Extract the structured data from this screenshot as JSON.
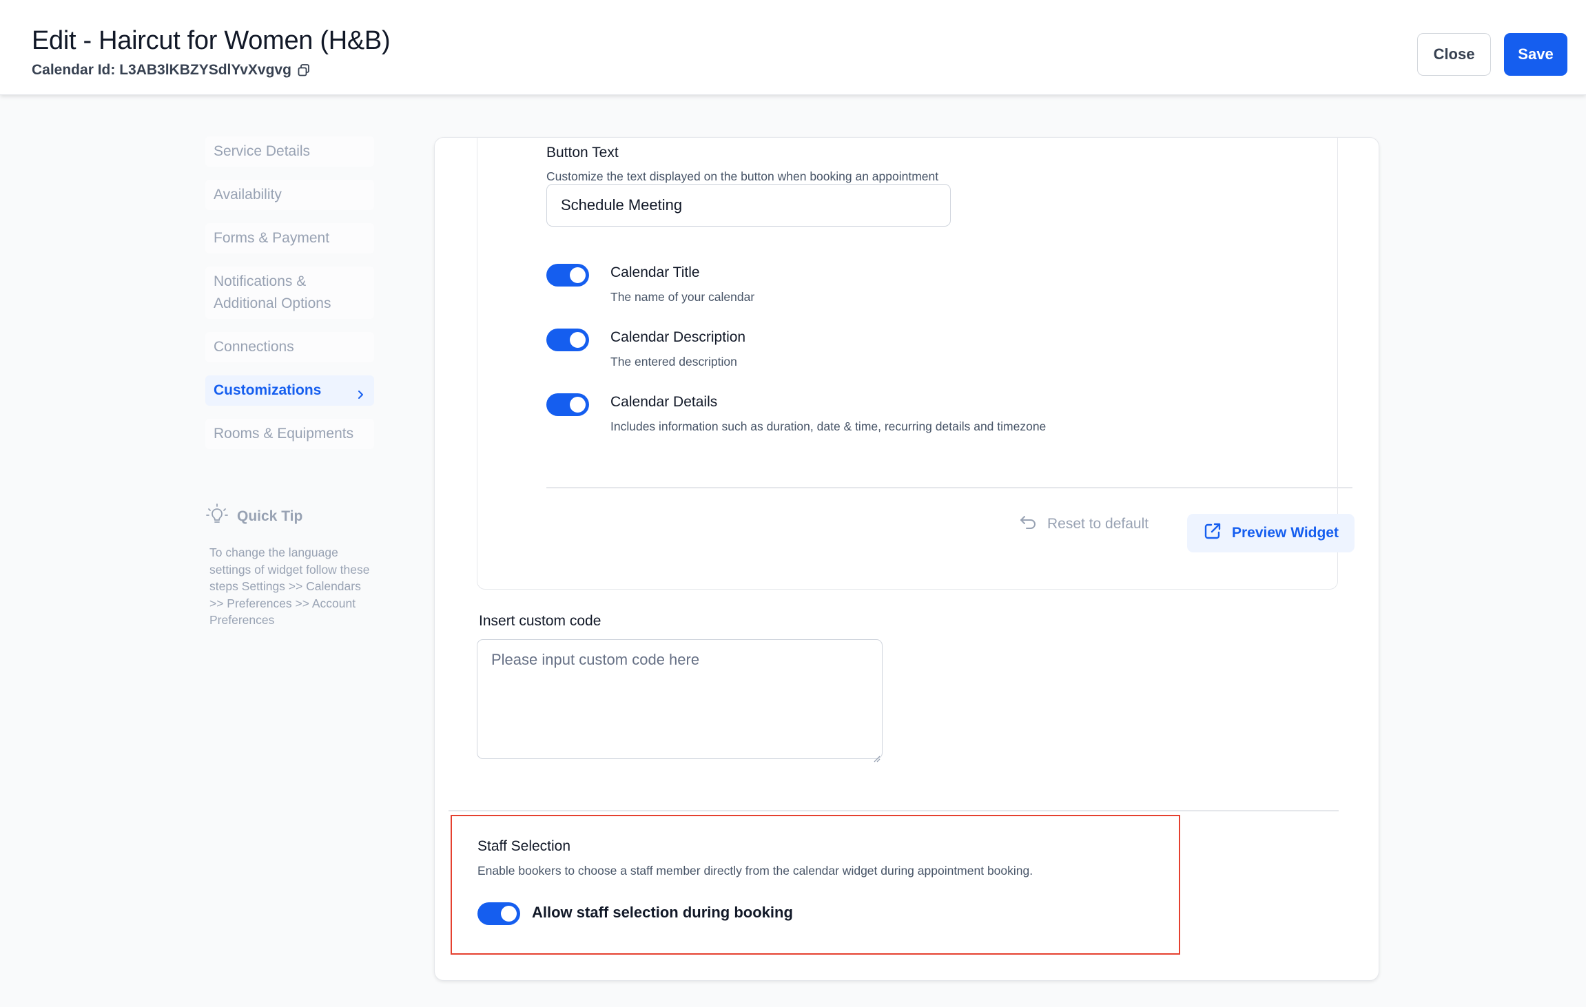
{
  "header": {
    "title": "Edit - Haircut for Women (H&B)",
    "calendar_id": "Calendar Id: L3AB3lKBZYSdlYvXvgvg",
    "close_label": "Close",
    "save_label": "Save"
  },
  "sidebar": {
    "items": [
      {
        "label": "Service Details"
      },
      {
        "label": "Availability"
      },
      {
        "label": "Forms & Payment"
      },
      {
        "label": "Notifications & Additional Options"
      },
      {
        "label": "Connections"
      },
      {
        "label": "Customizations",
        "active": true
      },
      {
        "label": "Rooms & Equipments"
      }
    ]
  },
  "quick_tip": {
    "title": "Quick Tip",
    "body": "To change the language settings of widget follow these steps Settings >> Calendars >> Preferences >> Account Preferences"
  },
  "widget": {
    "button_text_label": "Button Text",
    "button_text_help": "Customize the text displayed on the button when booking an appointment",
    "button_text_value": "Schedule Meeting",
    "toggles": [
      {
        "title": "Calendar Title",
        "desc": "The name of your calendar",
        "on": true
      },
      {
        "title": "Calendar Description",
        "desc": "The entered description",
        "on": true
      },
      {
        "title": "Calendar Details",
        "desc": "Includes information such as duration, date & time, recurring details and timezone",
        "on": true
      }
    ],
    "reset_label": "Reset to default",
    "preview_label": "Preview Widget"
  },
  "custom_code": {
    "label": "Insert custom code",
    "placeholder": "Please input custom code here"
  },
  "staff_selection": {
    "title": "Staff Selection",
    "desc": "Enable bookers to choose a staff member directly from the calendar widget during appointment booking.",
    "toggle_label": "Allow staff selection during booking",
    "on": true
  },
  "colors": {
    "accent": "#155eef",
    "highlight_border": "#e5402f"
  }
}
